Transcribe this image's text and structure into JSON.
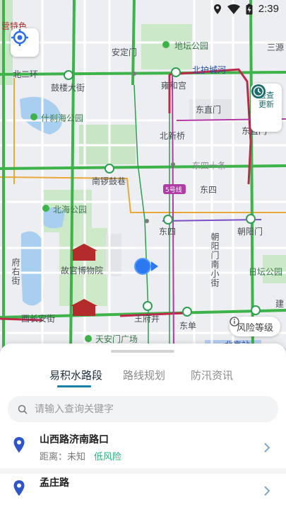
{
  "status_bar": {
    "time": "2:39"
  },
  "map": {
    "labels": {
      "top_left_fragment": "营特色",
      "anding_gate": "安定门",
      "ditan_park": "地坛公园",
      "sanyuan": "三源",
      "north_second_ring": "北二环",
      "north_second_ring_road": "北护城河",
      "drum_tower": "鼓楼大街",
      "yonghegong": "雍和宫",
      "dongzhimen": "东直门",
      "shichahai_park": "什刹海公园",
      "beixinqiao": "北新桥",
      "dongzhimen_right": "东直门",
      "dongsi_shitiao": "东四十条",
      "nanluoguxiang": "南锣鼓巷",
      "line5": "5号线",
      "dongsi": "东四",
      "beihai_park": "北海公园",
      "dongsi_station": "东四",
      "chaoyangmen": "朝阳门",
      "chaoyangmen_nanxiaojie": "朝阳门南小街",
      "fuyou_street": "府右街",
      "forbidden_city": "故宫博物院",
      "ritan_park": "日坛公园",
      "xichangan": "西长安街",
      "wangfujing": "王府井",
      "dongdan": "东单",
      "tiananmen_square": "天安门广场",
      "jian_fragment": "建",
      "beijing_station": "北京站"
    },
    "check_update_label": "检查更新",
    "risk_level_label": "风险等级"
  },
  "sheet": {
    "tabs": [
      {
        "label": "易积水路段",
        "active": true
      },
      {
        "label": "路线规划",
        "active": false
      },
      {
        "label": "防汛资讯",
        "active": false
      }
    ],
    "search_placeholder": "请输入查询关键字",
    "items": [
      {
        "name": "山西路济南路口",
        "distance": "距离：未知",
        "risk": "低风险"
      },
      {
        "name": "孟庄路"
      }
    ]
  },
  "colors": {
    "accent": "#1c7fa5",
    "low_risk": "#2bb57a",
    "pin": "#2f56c8",
    "road_green": "#3db34a",
    "road_red": "#c0284c",
    "road_yellow": "#e8a93a",
    "metro_pink": "#b13aa7"
  }
}
